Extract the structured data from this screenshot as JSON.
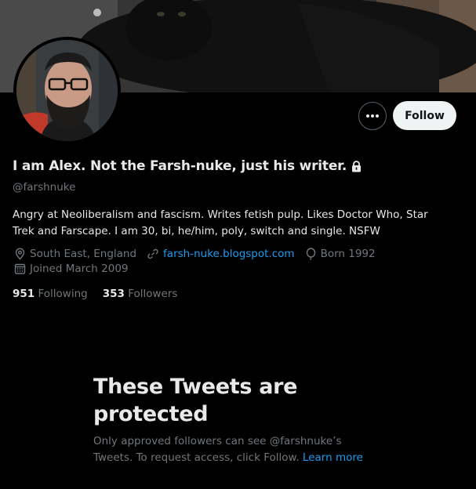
{
  "profile": {
    "display_name": "I am Alex. Not the Farsh-nuke, just his writer.",
    "handle": "@farshnuke",
    "bio": "Angry at Neoliberalism and fascism. Writes fetish pulp. Likes Doctor Who, Star Trek and Farscape. I am 30, bi, he/him, poly, switch and single. NSFW",
    "location": "South East, England",
    "website": "farsh-nuke.blogspot.com",
    "born": "Born 1992",
    "joined": "Joined March 2009",
    "icons": [
      "location-icon",
      "link-icon",
      "balloon-icon",
      "calendar-icon",
      "lock-icon"
    ]
  },
  "actions": {
    "follow_label": "Follow",
    "more_label": "More"
  },
  "stats": {
    "following_count": "951",
    "following_label": "Following",
    "followers_count": "353",
    "followers_label": "Followers"
  },
  "protected": {
    "title": "These Tweets are protected",
    "text": "Only approved followers can see @farshnuke’s Tweets. To request access, click Follow.",
    "learn_more": "Learn more"
  },
  "colors": {
    "background": "#000000",
    "text_primary": "#e7e9ea",
    "text_secondary": "#71767b",
    "link": "#1d9bf0",
    "follow_button_bg": "#eff3f4"
  }
}
